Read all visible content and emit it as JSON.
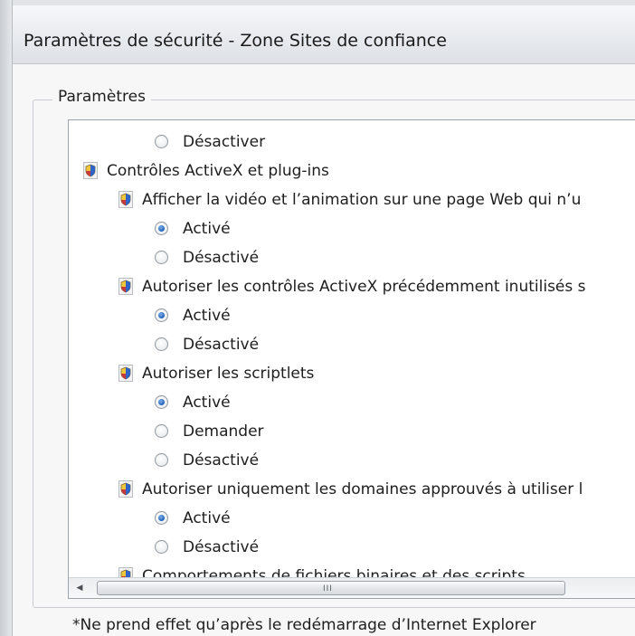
{
  "window": {
    "title": "Paramètres de sécurité - Zone Sites de confiance"
  },
  "group": {
    "label": "Paramètres"
  },
  "tree": {
    "rows": [
      {
        "type": "radio",
        "label": "Désactiver",
        "checked": false
      },
      {
        "type": "category",
        "label": "Contrôles ActiveX et plug-ins",
        "icon": "shield-icon"
      },
      {
        "type": "setting",
        "label": "Afficher la vidéo et l’animation sur une page Web qui n’u",
        "icon": "shield-icon"
      },
      {
        "type": "radio",
        "label": "Activé",
        "checked": true
      },
      {
        "type": "radio",
        "label": "Désactivé",
        "checked": false
      },
      {
        "type": "setting",
        "label": "Autoriser les contrôles ActiveX précédemment inutilisés s",
        "icon": "shield-icon"
      },
      {
        "type": "radio",
        "label": "Activé",
        "checked": true
      },
      {
        "type": "radio",
        "label": "Désactivé",
        "checked": false
      },
      {
        "type": "setting",
        "label": "Autoriser les scriptlets",
        "icon": "shield-icon"
      },
      {
        "type": "radio",
        "label": "Activé",
        "checked": true
      },
      {
        "type": "radio",
        "label": "Demander",
        "checked": false
      },
      {
        "type": "radio",
        "label": "Désactivé",
        "checked": false
      },
      {
        "type": "setting",
        "label": "Autoriser uniquement les domaines approuvés à utiliser l",
        "icon": "shield-icon"
      },
      {
        "type": "radio",
        "label": "Activé",
        "checked": true
      },
      {
        "type": "radio",
        "label": "Désactivé",
        "checked": false
      },
      {
        "type": "setting",
        "label": "Comportements de fichiers binaires et des scripts",
        "icon": "shield-icon"
      }
    ]
  },
  "scrollbar": {
    "left_arrow": "◀",
    "grip": "III"
  },
  "footnote": "*Ne prend effet qu’après le redémarrage d’Internet Explorer",
  "colors": {
    "accent": "#1d5fb8",
    "shield_blue": "#2f63c8",
    "shield_yellow": "#f3c53b",
    "shield_red": "#c83a3a"
  }
}
